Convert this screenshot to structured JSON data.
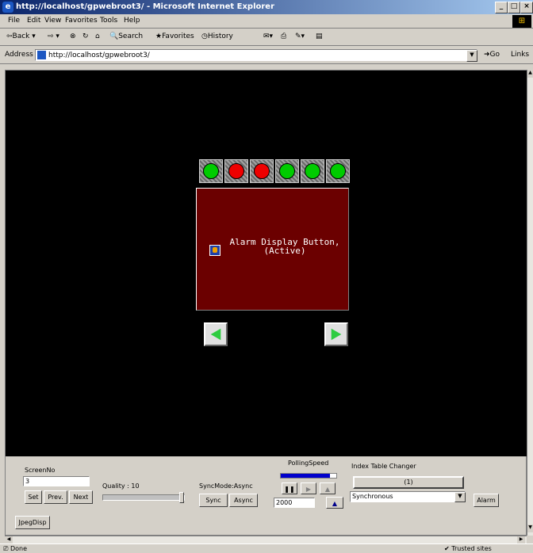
{
  "window": {
    "title": "http://localhost/gpwebroot3/ - Microsoft Internet Explorer",
    "controls": {
      "minimize": "_",
      "maximize": "□",
      "close": "×"
    }
  },
  "menu": [
    "File",
    "Edit",
    "View",
    "Favorites",
    "Tools",
    "Help"
  ],
  "toolbar": {
    "back": "⇦Back ▾",
    "forward": "⇨ ▾",
    "search": "Search",
    "favorites": "Favorites",
    "history": "History"
  },
  "address": {
    "label": "Address",
    "url": "http://localhost/gpwebroot3/",
    "go": "Go",
    "links": "Links"
  },
  "screen": {
    "lamps": [
      "#00cc00",
      "#ee0000",
      "#ee0000",
      "#00cc00",
      "#00cc00",
      "#00cc00"
    ],
    "alarm_line1": "Alarm Display Button,",
    "alarm_line2": "(Active)"
  },
  "controls": {
    "screen_no_label": "ScreenNo",
    "screen_no_value": "3",
    "set": "Set",
    "prev": "Prev.",
    "next": "Next",
    "quality_label": "Quality : 10",
    "quality_level": 1.0,
    "syncmode_label": "SyncMode:Async",
    "sync": "Sync",
    "async": "Async",
    "polling_label": "PollingSpeed",
    "polling_value": "2000",
    "index_label": "Index Table Changer",
    "index_value": "(1)",
    "sync_select": "Synchronous",
    "alarm": "Alarm",
    "jpeg": "JpegDisp"
  },
  "status": {
    "left": "Done",
    "zone": "Trusted sites"
  }
}
